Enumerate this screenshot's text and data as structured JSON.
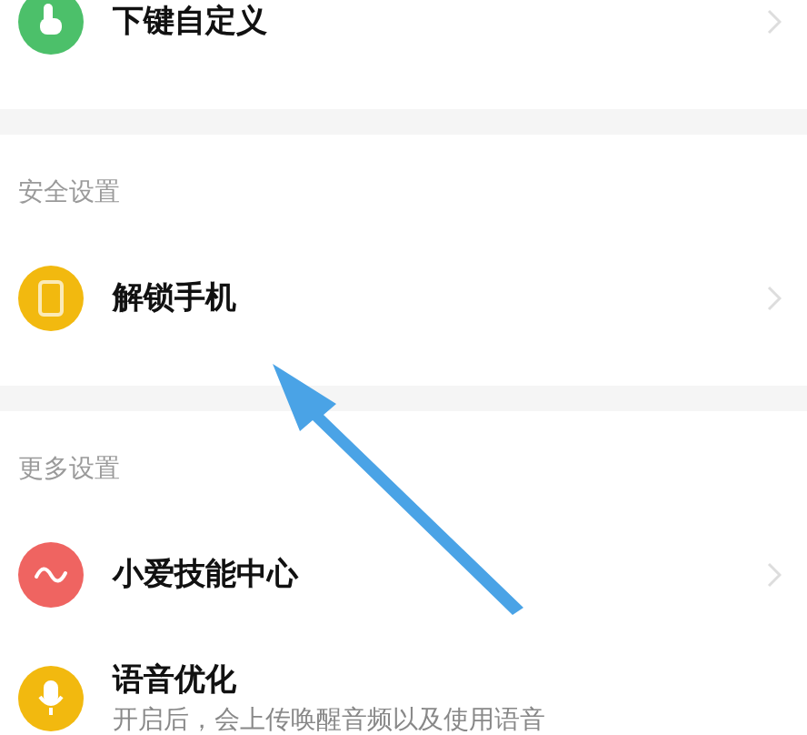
{
  "sections": [
    {
      "items": [
        {
          "title": "下键自定义",
          "color": "#4cc06a"
        }
      ]
    },
    {
      "header": "安全设置",
      "items": [
        {
          "title": "解锁手机",
          "color": "#f2b90f"
        }
      ]
    },
    {
      "header": "更多设置",
      "items": [
        {
          "title": "小爱技能中心",
          "color": "#ef6461"
        },
        {
          "title": "语音优化",
          "color": "#f2b90f",
          "description": "开启后，会上传唤醒音频以及使用语音"
        }
      ]
    }
  ]
}
